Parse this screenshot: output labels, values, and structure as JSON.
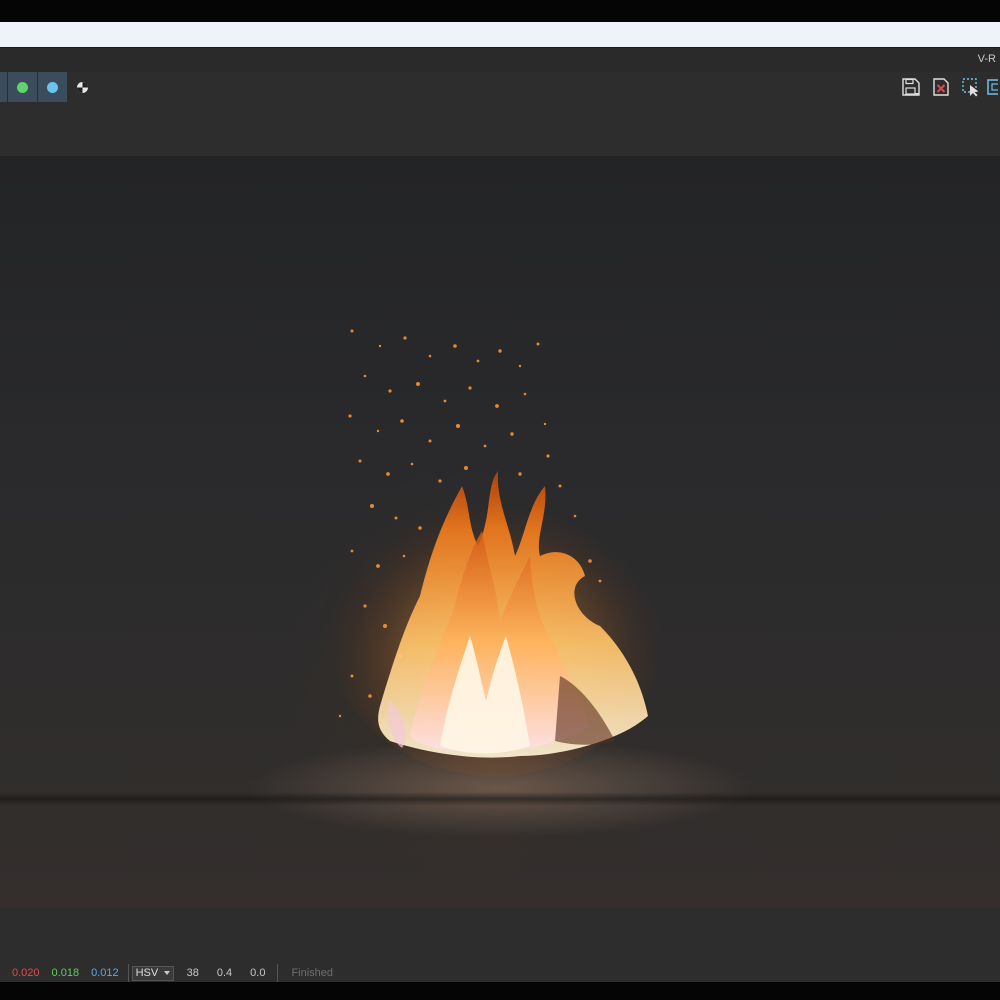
{
  "window": {
    "title": "V-R"
  },
  "toolbar": {
    "channels": [
      {
        "name": "green-channel",
        "color": "#62d26f"
      },
      {
        "name": "blue-channel",
        "color": "#6cc3f0"
      }
    ],
    "right_icons": [
      "save-icon",
      "clear-icon",
      "region-select-icon",
      "window-icon"
    ]
  },
  "status": {
    "r": "0.020",
    "g": "0.018",
    "b": "0.012",
    "mode": "HSV",
    "h": "38",
    "s": "0.4",
    "v": "0.0",
    "state": "Finished"
  },
  "colors": {
    "accent": "#3b4c5c",
    "red": "#e24a4a",
    "green": "#5fcf5f",
    "blue": "#5aa9e6"
  }
}
